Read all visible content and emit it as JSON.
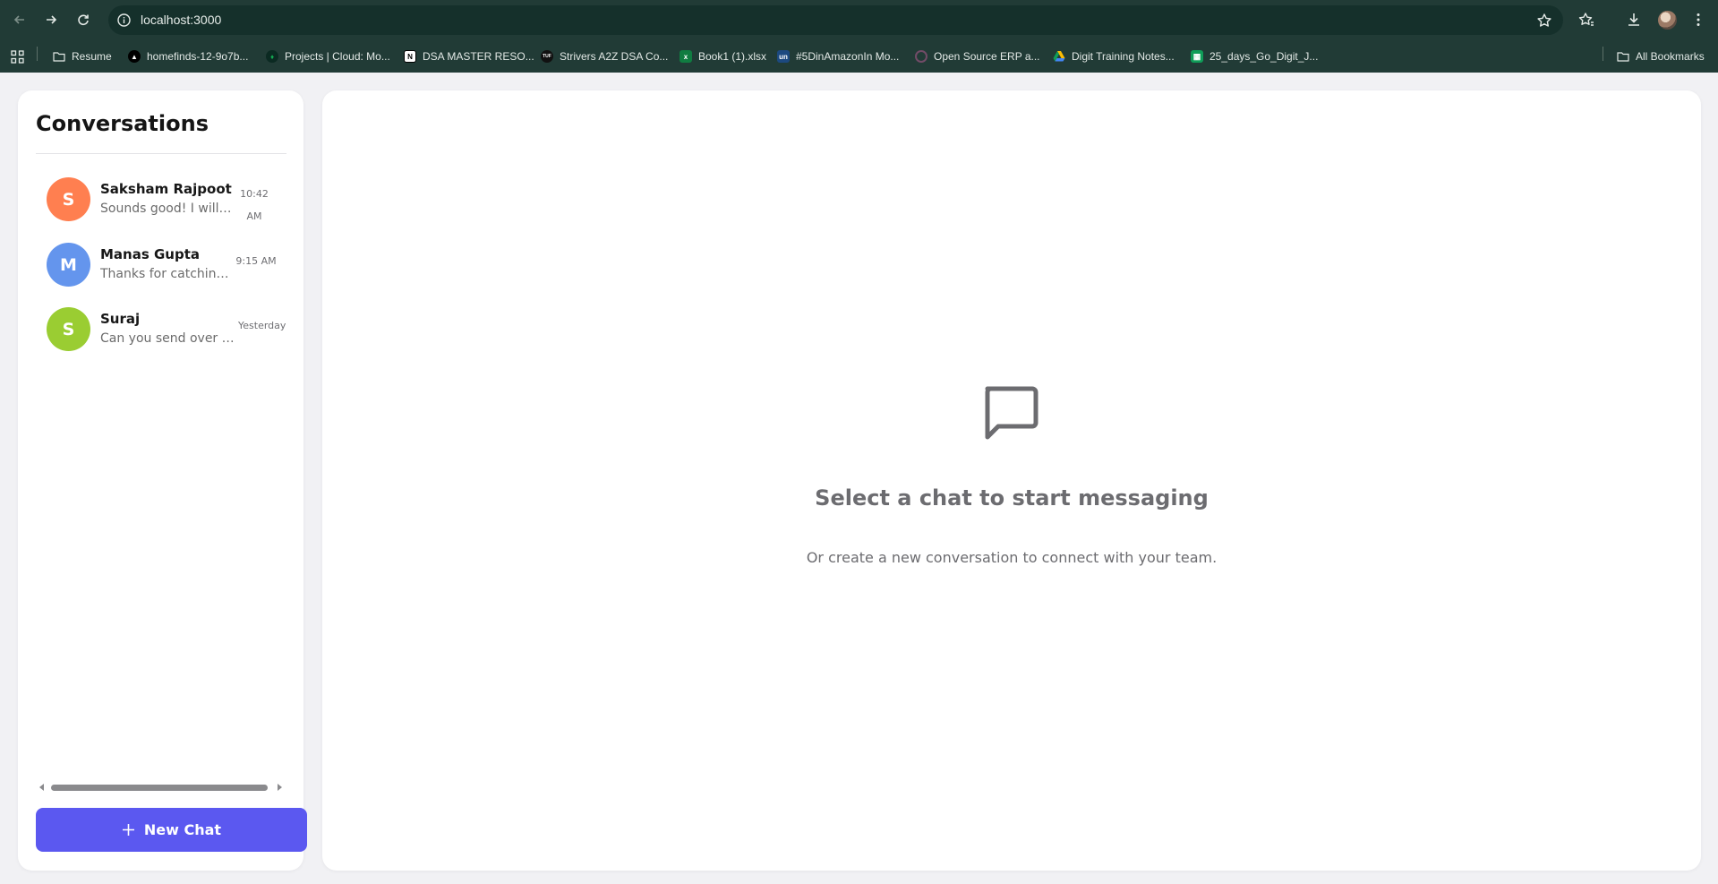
{
  "browser": {
    "url": "localhost:3000",
    "bookmarks": [
      {
        "label": "Resume",
        "icon": "folder-icon",
        "color": "#e3e9e6"
      },
      {
        "label": "homefinds-12-9o7b...",
        "icon": "vercel-triangle-icon",
        "color": "#000000"
      },
      {
        "label": "Projects | Cloud: Mo...",
        "icon": "mongodb-leaf-icon",
        "color": "#13aa52"
      },
      {
        "label": "DSA MASTER RESO...",
        "icon": "notion-icon",
        "color": "#ffffff"
      },
      {
        "label": "Strivers A2Z DSA Co...",
        "icon": "tuf-icon",
        "color": "#111111"
      },
      {
        "label": "Book1 (1).xlsx",
        "icon": "excel-icon",
        "color": "#107c41"
      },
      {
        "label": "#5DinAmazonIn Mo...",
        "icon": "unstop-icon",
        "color": "#1c4980"
      },
      {
        "label": "Open Source ERP a...",
        "icon": "erp-ring-icon",
        "color": "#714b67"
      },
      {
        "label": "Digit Training Notes...",
        "icon": "google-drive-icon",
        "color": "#fbbc04"
      },
      {
        "label": "25_days_Go_Digit_J...",
        "icon": "google-sheets-icon",
        "color": "#0f9d58"
      }
    ],
    "all_bookmarks_label": "All Bookmarks"
  },
  "sidebar": {
    "title": "Conversations",
    "conversations": [
      {
        "initial": "S",
        "name": "Saksham Rajpoot",
        "preview": "Sounds good! I will c...",
        "time": "10:42 AM",
        "avatar_color": "#ff7f50"
      },
      {
        "initial": "M",
        "name": "Manas Gupta",
        "preview": "Thanks for catching...",
        "time": "9:15 AM",
        "avatar_color": "#6495ed"
      },
      {
        "initial": "S",
        "name": "Suraj",
        "preview": "Can you send over t...",
        "time": "Yesterday",
        "avatar_color": "#9acd32"
      }
    ],
    "new_chat_label": "New Chat"
  },
  "main": {
    "empty_title": "Select a chat to start messaging",
    "empty_subtitle": "Or create a new conversation to connect with your team."
  },
  "colors": {
    "accent": "#5b58f0",
    "chrome": "#213b36",
    "background": "#f1f1f4"
  }
}
